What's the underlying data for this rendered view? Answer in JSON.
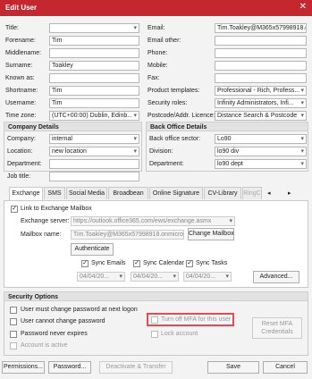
{
  "window": {
    "title": "Edit User",
    "close_glyph": "✕"
  },
  "personal": {
    "left": [
      {
        "label": "Title:",
        "value": ""
      },
      {
        "label": "Forename:",
        "value": "Tim"
      },
      {
        "label": "Middlename:",
        "value": ""
      },
      {
        "label": "Surname:",
        "value": "Toakley"
      },
      {
        "label": "Known as:",
        "value": ""
      },
      {
        "label": "Shortname:",
        "value": "Tim"
      },
      {
        "label": "Username:",
        "value": "Tim"
      },
      {
        "label": "Time zone:",
        "value": "(UTC+00:00) Dublin, Edinb..."
      }
    ],
    "right": [
      {
        "label": "Email:",
        "value": "Tim.Toakley@M365x57998918.o"
      },
      {
        "label": "Email other:",
        "value": ""
      },
      {
        "label": "Phone:",
        "value": ""
      },
      {
        "label": "Mobile:",
        "value": ""
      },
      {
        "label": "Fax:",
        "value": ""
      },
      {
        "label": "Product templates:",
        "value": "Professional - Rich, Profess..."
      },
      {
        "label": "Security roles:",
        "value": "Infinity Administrators, Infi..."
      },
      {
        "label": "Postcode/Addr. Licence:",
        "value": "Distance Search & Postcode"
      }
    ]
  },
  "company": {
    "header": "Company Details",
    "fields": [
      {
        "label": "Company:",
        "value": "internal"
      },
      {
        "label": "Location:",
        "value": "new location"
      },
      {
        "label": "Department:",
        "value": ""
      },
      {
        "label": "Job title:",
        "value": ""
      }
    ]
  },
  "backoffice": {
    "header": "Back Office Details",
    "fields": [
      {
        "label": "Back office sector:",
        "value": "Lo90"
      },
      {
        "label": "Division:",
        "value": "lo90 div"
      },
      {
        "label": "Department:",
        "value": "lo90 dept"
      }
    ]
  },
  "tabs": [
    "Exchange",
    "SMS",
    "Social Media",
    "Broadbean",
    "Online Signature",
    "CV-Library",
    "RingC"
  ],
  "tab_nav": {
    "prev": "◂",
    "next": "▸"
  },
  "exchange": {
    "link_label": "Link to Exchange Mailbox",
    "link_checked": "✓",
    "server_label": "Exchange server:",
    "server_value": "https://outlook.office365.com/ews/exchange.asmx",
    "mailbox_label": "Mailbox name:",
    "mailbox_value": "Tim.Toakley@M365x57998918.onmicros...",
    "change_mailbox": "Change Mailbox",
    "authenticate": "Authenticate",
    "sync_emails": "Sync Emails",
    "sync_calendar": "Sync Calendar",
    "sync_tasks": "Sync Tasks",
    "sync_date": "04/04/20...",
    "check": "✓",
    "advanced": "Advanced..."
  },
  "security": {
    "header": "Security Options",
    "must_change": "User must change password at next logon",
    "cannot_change": "User cannot change password",
    "never_expires": "Password never expires",
    "account_active": "Account is active",
    "turn_off_mfa": "Turn off MFA for this user",
    "lock_account": "Lock account",
    "reset_mfa": "Reset MFA Credentials"
  },
  "footer": {
    "permissions": "Permissions...",
    "password": "Password...",
    "deactivate": "Deactivate & Transfer",
    "save": "Save",
    "cancel": "Cancel"
  },
  "colors": {
    "titlebar": "#c5272e",
    "highlight": "#e04c54",
    "panel": "#f3f3f3"
  }
}
